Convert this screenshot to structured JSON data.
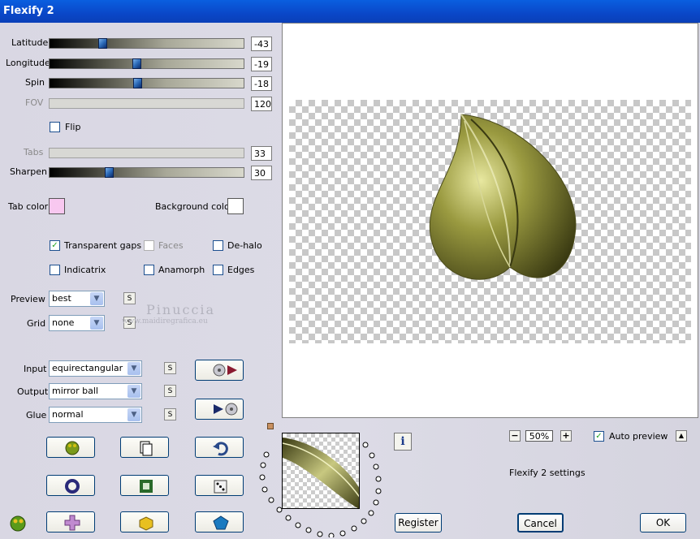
{
  "window": {
    "title": "Flexify 2"
  },
  "sliders": [
    {
      "id": "latitude",
      "label": "Latitude",
      "value": "-43",
      "fraction": 0.27,
      "enabled": true
    },
    {
      "id": "longitude",
      "label": "Longitude",
      "value": "-19",
      "fraction": 0.45,
      "enabled": true
    },
    {
      "id": "spin",
      "label": "Spin",
      "value": "-18",
      "fraction": 0.455,
      "enabled": true
    },
    {
      "id": "fov",
      "label": "FOV",
      "value": "120",
      "fraction": 0,
      "enabled": false
    },
    {
      "id": "tabs",
      "label": "Tabs",
      "value": "33",
      "fraction": 0,
      "enabled": false
    },
    {
      "id": "sharpen",
      "label": "Sharpen",
      "value": "30",
      "fraction": 0.3,
      "enabled": true
    }
  ],
  "flip": {
    "label": "Flip",
    "checked": false
  },
  "colors": {
    "tab_color_label": "Tab color",
    "tab_color": "#f8c8f0",
    "background_color_label": "Background color",
    "background_color": "#ffffff"
  },
  "options": {
    "transparent_gaps": {
      "label": "Transparent gaps",
      "checked": true
    },
    "faces": {
      "label": "Faces",
      "checked": false
    },
    "de_halo": {
      "label": "De-halo",
      "checked": false
    },
    "indicatrix": {
      "label": "Indicatrix",
      "checked": false
    },
    "anamorph": {
      "label": "Anamorph",
      "checked": false
    },
    "edges": {
      "label": "Edges",
      "checked": false
    }
  },
  "preview_select": {
    "label": "Preview",
    "value": "best"
  },
  "grid_select": {
    "label": "Grid",
    "value": "none"
  },
  "input_select": {
    "label": "Input",
    "value": "equirectangular"
  },
  "output_select": {
    "label": "Output",
    "value": "mirror ball"
  },
  "glue_select": {
    "label": "Glue",
    "value": "normal"
  },
  "s_button_label": "S",
  "watermark": {
    "line1": "Pinuccia",
    "line2": "www.maidiregrafica.eu"
  },
  "zoom": {
    "value": "50%",
    "minus": "−",
    "plus": "+"
  },
  "auto_preview": {
    "label": "Auto preview",
    "checked": true
  },
  "scroll_up": "▲",
  "settings_label": "Flexify 2 settings",
  "info_label": "i",
  "buttons": {
    "register": "Register",
    "cancel": "Cancel",
    "ok": "OK"
  },
  "accent_colors": {
    "leaf": "#8a8a3a",
    "titlebar": "#0a47c8"
  }
}
